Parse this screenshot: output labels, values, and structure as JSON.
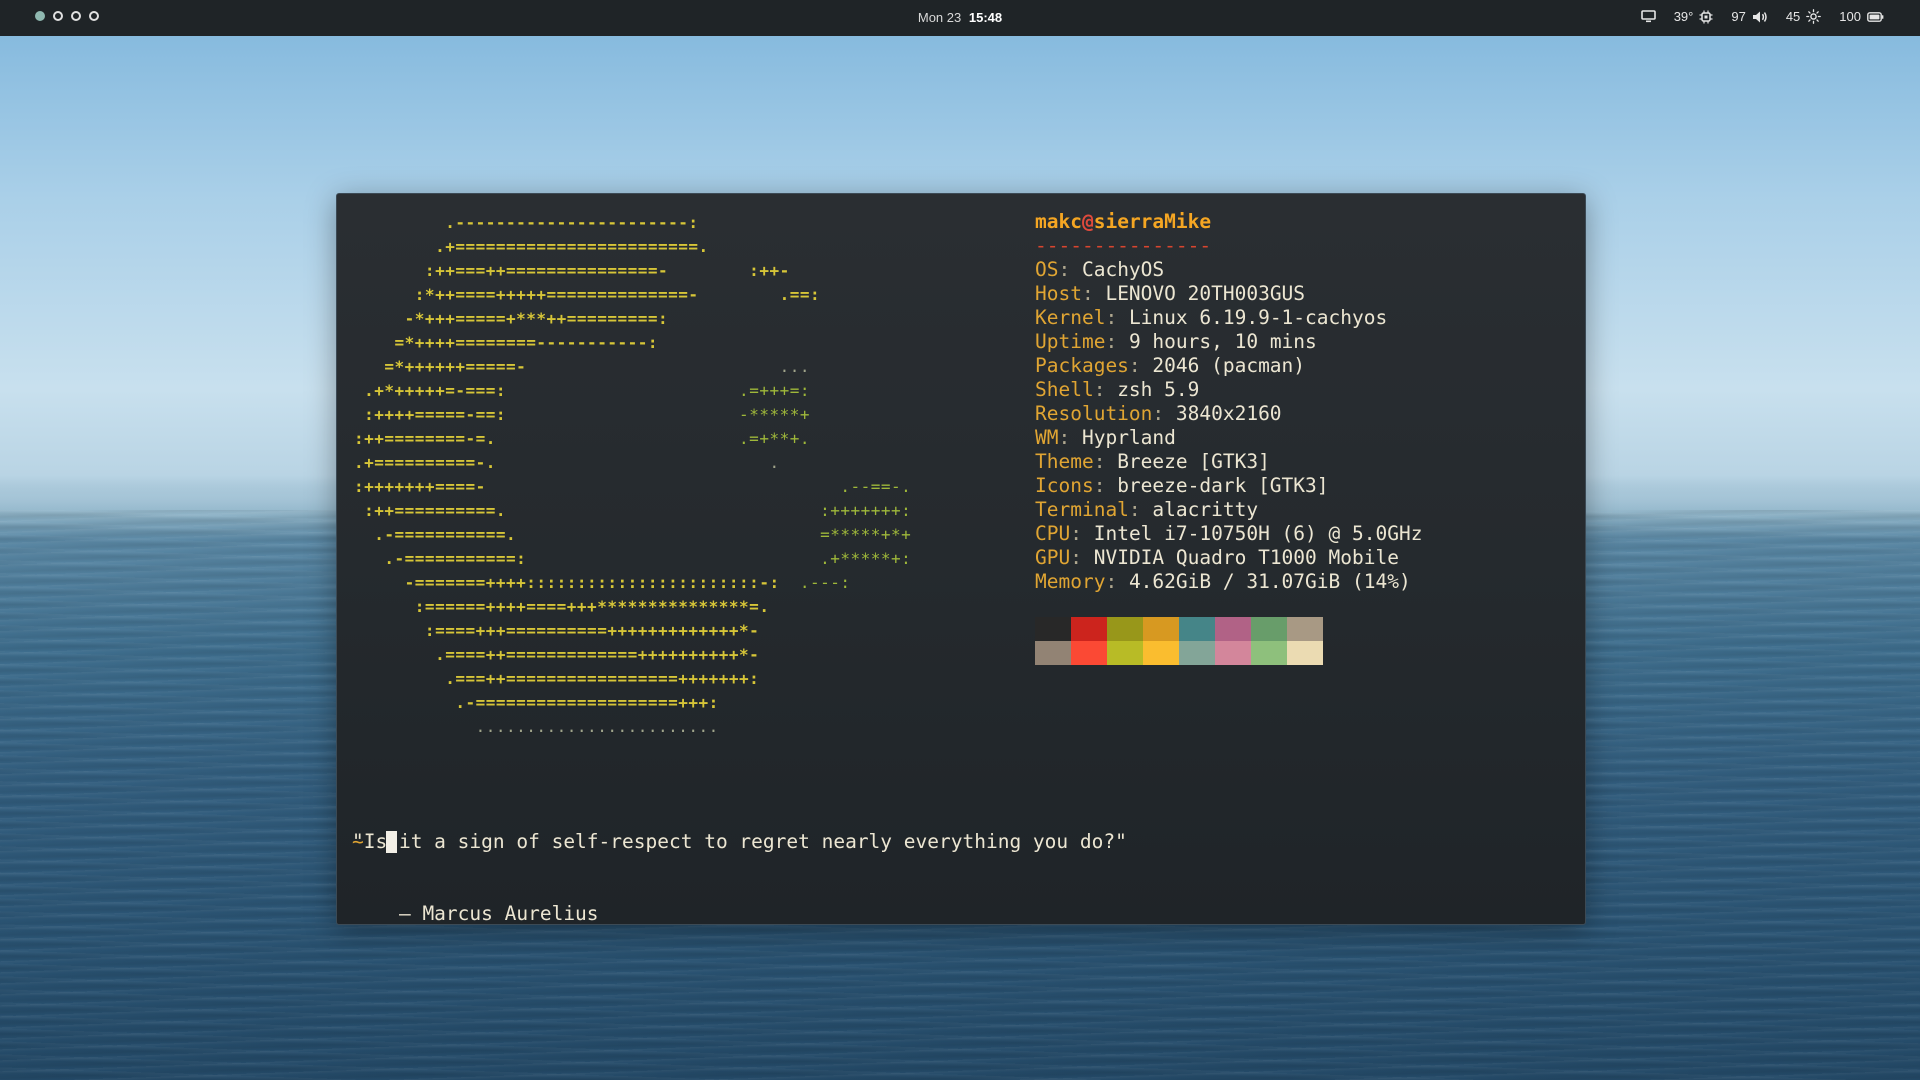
{
  "topbar": {
    "workspaces": [
      {
        "id": 1,
        "active": true
      },
      {
        "id": 2,
        "active": false
      },
      {
        "id": 3,
        "active": false
      },
      {
        "id": 4,
        "active": false
      }
    ],
    "date": "Mon 23",
    "time": "15:48",
    "tray": {
      "display_icon": "monitor-icon",
      "cpu_temp": "39°",
      "cpu_icon": "cpu-chip-icon",
      "volume": "97",
      "volume_icon": "speaker-icon",
      "brightness": "45",
      "brightness_icon": "sun-icon",
      "battery": "100",
      "battery_icon": "battery-icon"
    }
  },
  "terminal": {
    "ascii_logo": {
      "lines": [
        [
          [
            "y",
            "         .-----------------------:"
          ]
        ],
        [
          [
            "y",
            "        .+========================."
          ]
        ],
        [
          [
            "y",
            "       :++===++===============-        :++-"
          ]
        ],
        [
          [
            "y",
            "      :*++====+++++==============-        .==:"
          ]
        ],
        [
          [
            "y",
            "     -*+++=====+***++=========:"
          ]
        ],
        [
          [
            "y",
            "    =*++++========-----------:"
          ]
        ],
        [
          [
            "y",
            "   =*++++++=====-"
          ],
          [
            "d",
            "                         ..."
          ]
        ],
        [
          [
            "y",
            " .+*+++++=-===:"
          ],
          [
            "g",
            "                       .=+++=:"
          ]
        ],
        [
          [
            "y",
            " :++++=====-==:"
          ],
          [
            "g",
            "                       -*****+"
          ]
        ],
        [
          [
            "y",
            ":++========-=."
          ],
          [
            "g",
            "                        .=+**+."
          ]
        ],
        [
          [
            "y",
            ".+==========-."
          ],
          [
            "d",
            "                           ."
          ]
        ],
        [
          [
            "y",
            ":+++++++====-"
          ],
          [
            "g",
            "                                   .--==-."
          ]
        ],
        [
          [
            "y",
            " :++==========."
          ],
          [
            "g",
            "                               :+++++++:"
          ]
        ],
        [
          [
            "y",
            "  .-===========."
          ],
          [
            "g",
            "                              =*****+*+"
          ]
        ],
        [
          [
            "y",
            "   .-===========:"
          ],
          [
            "g",
            "                             .+*****+:"
          ]
        ],
        [
          [
            "y",
            "     -=======++++:::::::::::::::::::::::-:"
          ],
          [
            "g",
            "  .---:"
          ]
        ],
        [
          [
            "y",
            "      :======++++====+++***************=."
          ]
        ],
        [
          [
            "y",
            "       :====+++==========+++++++++++++*-"
          ]
        ],
        [
          [
            "y",
            "        .====++=============++++++++++*-"
          ]
        ],
        [
          [
            "y",
            "         .===++=================+++++++:"
          ]
        ],
        [
          [
            "y",
            "          .-====================+++:"
          ]
        ],
        [
          [
            "d",
            "            ........................"
          ]
        ]
      ]
    },
    "info": {
      "user": "makc",
      "at": "@",
      "host": "sierraMike",
      "separator": "---------------",
      "rows": [
        {
          "key": "OS",
          "value": "CachyOS"
        },
        {
          "key": "Host",
          "value": "LENOVO 20TH003GUS"
        },
        {
          "key": "Kernel",
          "value": "Linux 6.19.9-1-cachyos"
        },
        {
          "key": "Uptime",
          "value": "9 hours, 10 mins"
        },
        {
          "key": "Packages",
          "value": "2046 (pacman)"
        },
        {
          "key": "Shell",
          "value": "zsh 5.9"
        },
        {
          "key": "Resolution",
          "value": "3840x2160"
        },
        {
          "key": "WM",
          "value": "Hyprland"
        },
        {
          "key": "Theme",
          "value": "Breeze [GTK3]"
        },
        {
          "key": "Icons",
          "value": "breeze-dark [GTK3]"
        },
        {
          "key": "Terminal",
          "value": "alacritty"
        },
        {
          "key": "CPU",
          "value": "Intel i7-10750H (6) @ 5.0GHz"
        },
        {
          "key": "GPU",
          "value": "NVIDIA Quadro T1000 Mobile"
        },
        {
          "key": "Memory",
          "value": "4.62GiB / 31.07GiB (14%)"
        }
      ]
    },
    "palette": [
      "#282828",
      "#cc241d",
      "#98971a",
      "#d79921",
      "#458588",
      "#b16286",
      "#689d6a",
      "#a89984",
      "#928374",
      "#fb4934",
      "#b8bb26",
      "#fabd2f",
      "#83a598",
      "#d3869b",
      "#8ec07c",
      "#ebdbb2"
    ],
    "quote": "\"Is it a sign of self-respect to regret nearly everything you do?\"",
    "quote_author": "    — Marcus Aurelius",
    "prompt": "~"
  }
}
